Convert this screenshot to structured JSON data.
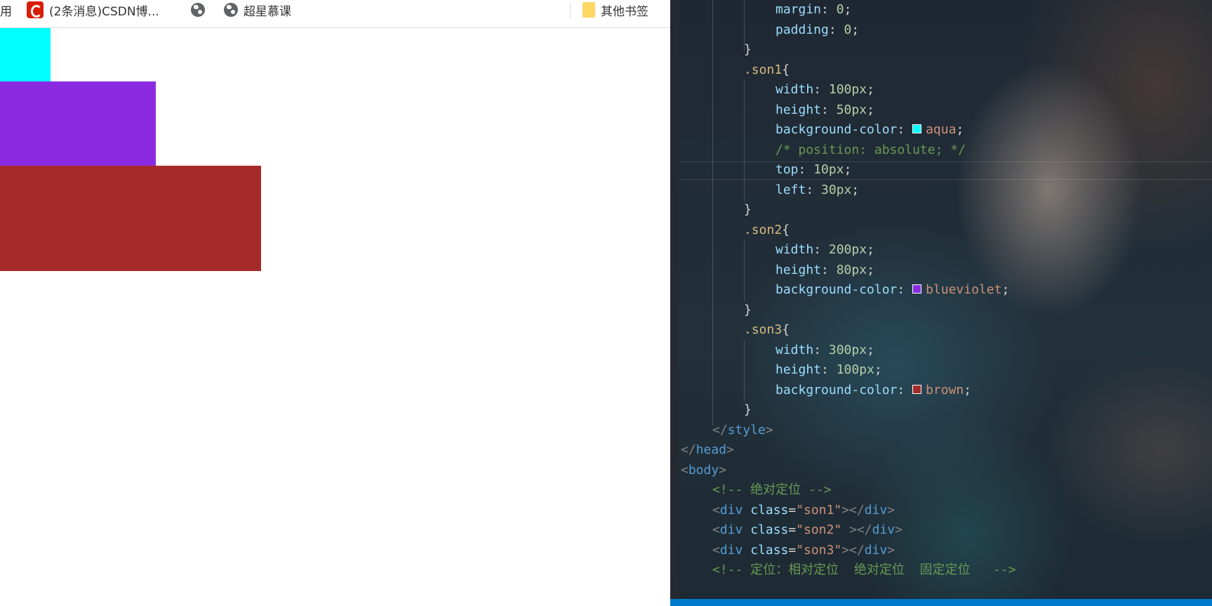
{
  "bookmarks": {
    "items": [
      {
        "label": "用",
        "icon": "none"
      },
      {
        "label": "(2条消息)CSDN博...",
        "icon": "csdn-icon"
      },
      {
        "label": "",
        "icon": "globe-icon"
      },
      {
        "label": "超星慕课",
        "icon": "globe-icon"
      }
    ],
    "other_label": "其他书签",
    "other_icon": "folder-icon"
  },
  "preview": {
    "boxes": [
      {
        "class": "son1",
        "color": "#00ffff"
      },
      {
        "class": "son2",
        "color": "#8a2be2"
      },
      {
        "class": "son3",
        "color": "#a52a2a"
      }
    ]
  },
  "editor": {
    "lines": [
      {
        "indent": 3,
        "tokens": [
          [
            "prop",
            "margin"
          ],
          [
            "punct",
            ": "
          ],
          [
            "num",
            "0"
          ],
          [
            "punct",
            ";"
          ]
        ]
      },
      {
        "indent": 3,
        "tokens": [
          [
            "prop",
            "padding"
          ],
          [
            "punct",
            ": "
          ],
          [
            "num",
            "0"
          ],
          [
            "punct",
            ";"
          ]
        ]
      },
      {
        "indent": 2,
        "tokens": [
          [
            "punct",
            "}"
          ]
        ]
      },
      {
        "indent": 2,
        "tokens": [
          [
            "sel",
            ".son1"
          ],
          [
            "punct",
            "{"
          ]
        ]
      },
      {
        "indent": 3,
        "tokens": [
          [
            "prop",
            "width"
          ],
          [
            "punct",
            ": "
          ],
          [
            "num",
            "100px"
          ],
          [
            "punct",
            ";"
          ]
        ]
      },
      {
        "indent": 3,
        "tokens": [
          [
            "prop",
            "height"
          ],
          [
            "punct",
            ": "
          ],
          [
            "num",
            "50px"
          ],
          [
            "punct",
            ";"
          ]
        ]
      },
      {
        "indent": 3,
        "tokens": [
          [
            "prop",
            "background-color"
          ],
          [
            "punct",
            ": "
          ],
          [
            "swatch",
            "#00ffff"
          ],
          [
            "color",
            "aqua"
          ],
          [
            "punct",
            ";"
          ]
        ]
      },
      {
        "indent": 3,
        "tokens": [
          [
            "comment",
            "/* position: absolute; */"
          ]
        ]
      },
      {
        "indent": 3,
        "tokens": [
          [
            "prop",
            "top"
          ],
          [
            "punct",
            ": "
          ],
          [
            "num",
            "10px"
          ],
          [
            "punct",
            ";"
          ]
        ]
      },
      {
        "indent": 3,
        "tokens": [
          [
            "prop",
            "left"
          ],
          [
            "punct",
            ": "
          ],
          [
            "num",
            "30px"
          ],
          [
            "punct",
            ";"
          ]
        ]
      },
      {
        "indent": 2,
        "tokens": [
          [
            "punct",
            "}"
          ]
        ]
      },
      {
        "indent": 2,
        "tokens": [
          [
            "sel",
            ".son2"
          ],
          [
            "punct",
            "{"
          ]
        ]
      },
      {
        "indent": 3,
        "tokens": [
          [
            "prop",
            "width"
          ],
          [
            "punct",
            ": "
          ],
          [
            "num",
            "200px"
          ],
          [
            "punct",
            ";"
          ]
        ]
      },
      {
        "indent": 3,
        "tokens": [
          [
            "prop",
            "height"
          ],
          [
            "punct",
            ": "
          ],
          [
            "num",
            "80px"
          ],
          [
            "punct",
            ";"
          ]
        ]
      },
      {
        "indent": 3,
        "tokens": [
          [
            "prop",
            "background-color"
          ],
          [
            "punct",
            ": "
          ],
          [
            "swatch",
            "#8a2be2"
          ],
          [
            "color",
            "blueviolet"
          ],
          [
            "punct",
            ";"
          ]
        ]
      },
      {
        "indent": 2,
        "tokens": [
          [
            "punct",
            "}"
          ]
        ]
      },
      {
        "indent": 2,
        "tokens": [
          [
            "sel",
            ".son3"
          ],
          [
            "punct",
            "{"
          ]
        ]
      },
      {
        "indent": 3,
        "tokens": [
          [
            "prop",
            "width"
          ],
          [
            "punct",
            ": "
          ],
          [
            "num",
            "300px"
          ],
          [
            "punct",
            ";"
          ]
        ]
      },
      {
        "indent": 3,
        "tokens": [
          [
            "prop",
            "height"
          ],
          [
            "punct",
            ": "
          ],
          [
            "num",
            "100px"
          ],
          [
            "punct",
            ";"
          ]
        ]
      },
      {
        "indent": 3,
        "tokens": [
          [
            "prop",
            "background-color"
          ],
          [
            "punct",
            ": "
          ],
          [
            "swatch",
            "#a52a2a"
          ],
          [
            "color",
            "brown"
          ],
          [
            "punct",
            ";"
          ]
        ]
      },
      {
        "indent": 2,
        "tokens": [
          [
            "punct",
            "}"
          ]
        ]
      },
      {
        "indent": 1,
        "tokens": [
          [
            "bracket",
            "</"
          ],
          [
            "tag",
            "style"
          ],
          [
            "bracket",
            ">"
          ]
        ]
      },
      {
        "indent": 0,
        "tokens": [
          [
            "bracket",
            "</"
          ],
          [
            "tag",
            "head"
          ],
          [
            "bracket",
            ">"
          ]
        ]
      },
      {
        "indent": 0,
        "tokens": [
          [
            "bracket",
            "<"
          ],
          [
            "tag",
            "body"
          ],
          [
            "bracket",
            ">"
          ]
        ]
      },
      {
        "indent": 1,
        "tokens": [
          [
            "comment",
            "<!-- 绝对定位 -->"
          ]
        ]
      },
      {
        "indent": 1,
        "tokens": [
          [
            "bracket",
            "<"
          ],
          [
            "tag",
            "div"
          ],
          [
            "punct",
            " "
          ],
          [
            "attr",
            "class"
          ],
          [
            "punct",
            "="
          ],
          [
            "str",
            "\"son1\""
          ],
          [
            "bracket",
            "></"
          ],
          [
            "tag",
            "div"
          ],
          [
            "bracket",
            ">"
          ]
        ]
      },
      {
        "indent": 1,
        "tokens": [
          [
            "bracket",
            "<"
          ],
          [
            "tag",
            "div"
          ],
          [
            "punct",
            " "
          ],
          [
            "attr",
            "class"
          ],
          [
            "punct",
            "="
          ],
          [
            "str",
            "\"son2\""
          ],
          [
            "punct",
            " "
          ],
          [
            "bracket",
            "></"
          ],
          [
            "tag",
            "div"
          ],
          [
            "bracket",
            ">"
          ]
        ]
      },
      {
        "indent": 1,
        "tokens": [
          [
            "bracket",
            "<"
          ],
          [
            "tag",
            "div"
          ],
          [
            "punct",
            " "
          ],
          [
            "attr",
            "class"
          ],
          [
            "punct",
            "="
          ],
          [
            "str",
            "\"son3\""
          ],
          [
            "bracket",
            "></"
          ],
          [
            "tag",
            "div"
          ],
          [
            "bracket",
            ">"
          ]
        ]
      },
      {
        "indent": 1,
        "tokens": [
          [
            "comment",
            "<!-- 定位：相对定位  绝对定位  固定定位   -->"
          ]
        ]
      }
    ]
  }
}
